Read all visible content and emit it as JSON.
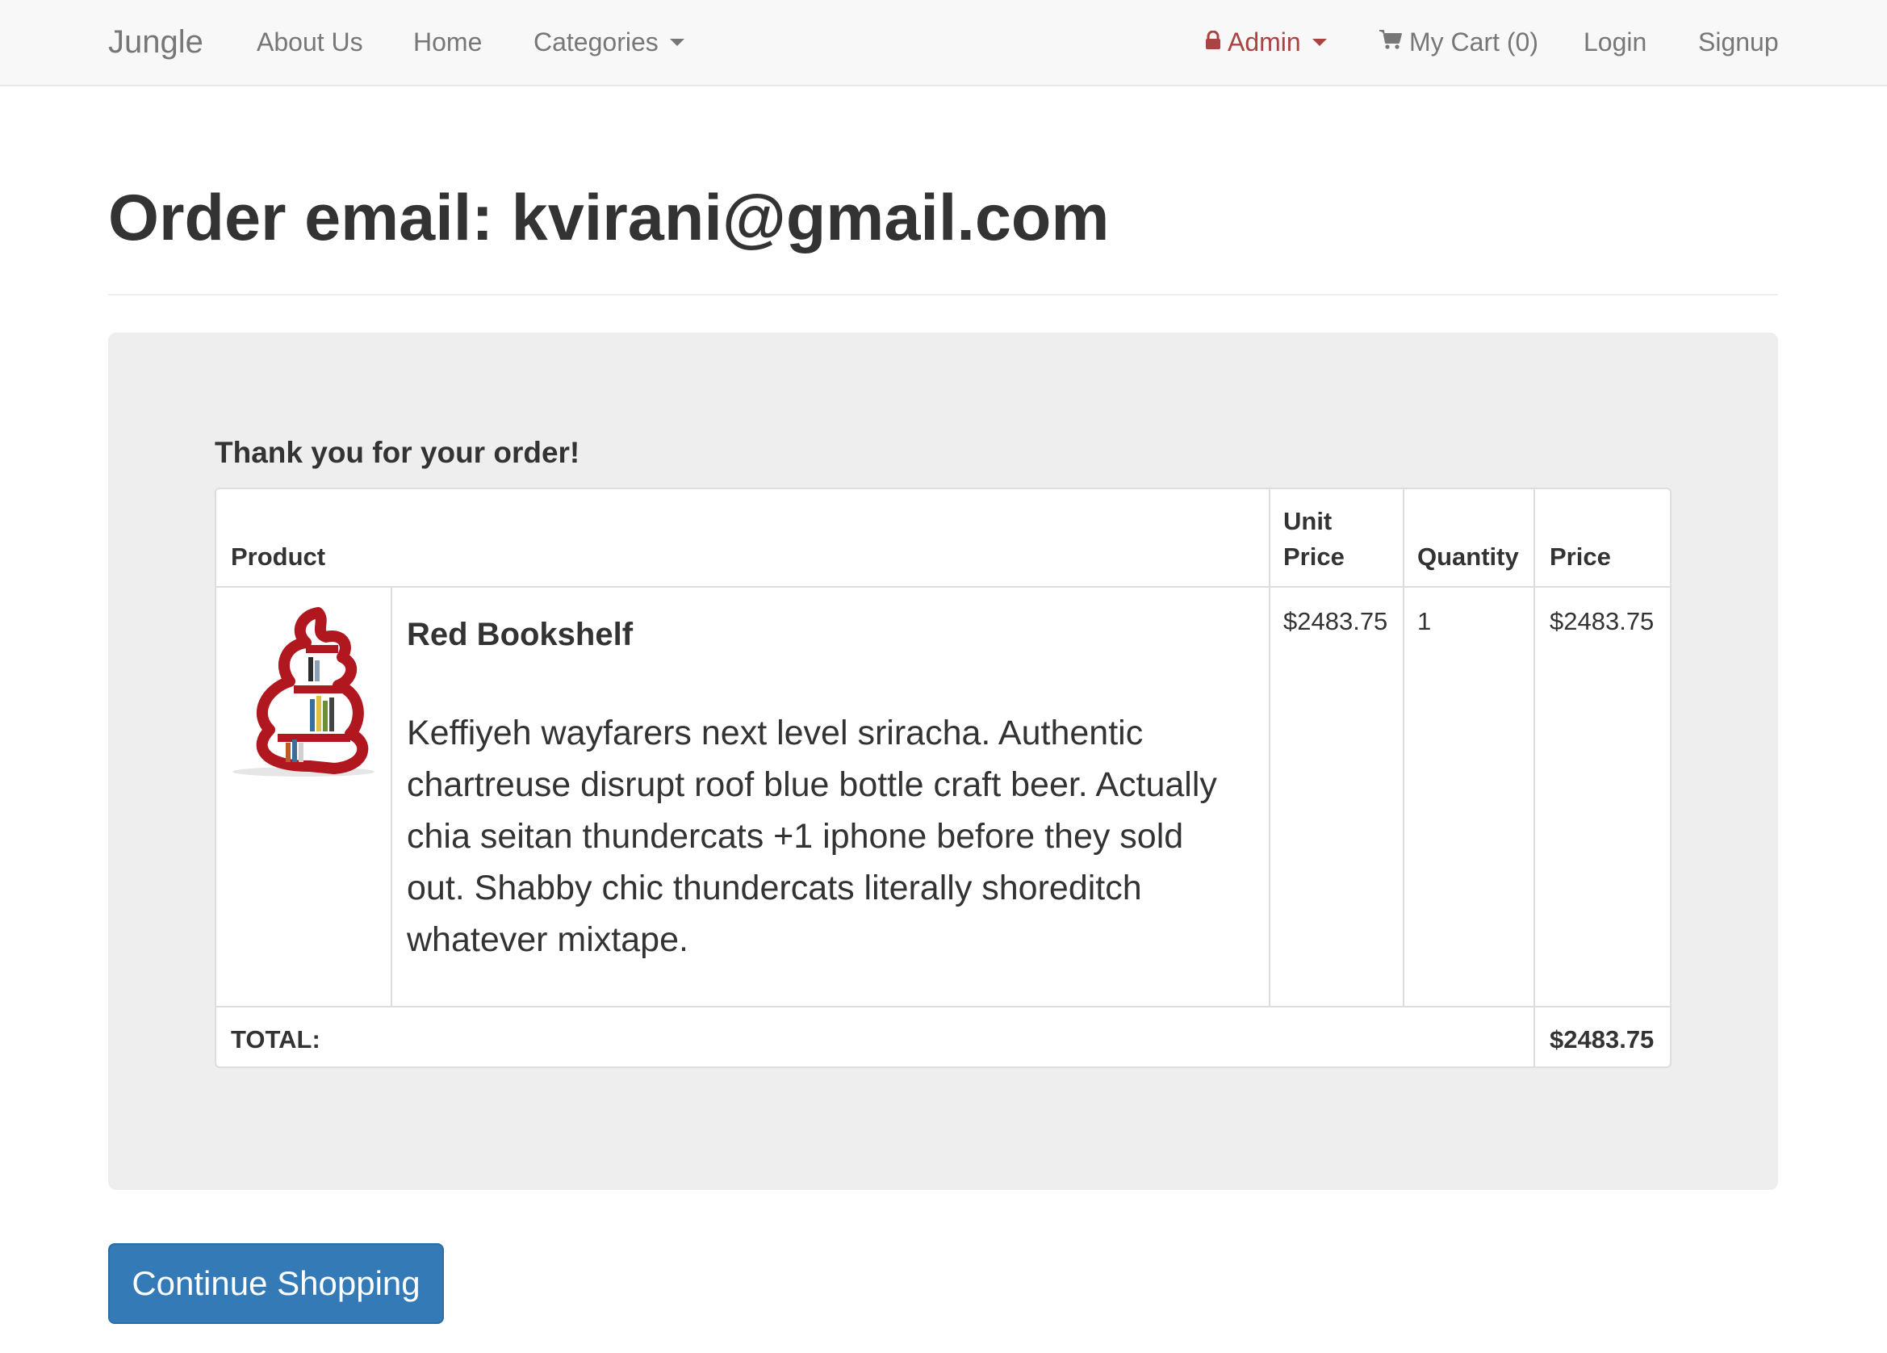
{
  "navbar": {
    "brand": "Jungle",
    "about": "About Us",
    "home": "Home",
    "categories": "Categories",
    "admin": "Admin",
    "cart": "My Cart (0)",
    "login": "Login",
    "signup": "Signup"
  },
  "page": {
    "title": "Order email: kvirani@gmail.com",
    "thanks": "Thank you for your order!"
  },
  "table": {
    "headers": {
      "product": "Product",
      "unit_price_line1": "Unit",
      "unit_price_line2": "Price",
      "quantity": "Quantity",
      "price": "Price"
    },
    "items": [
      {
        "name": "Red Bookshelf",
        "description": "Keffiyeh wayfarers next level sriracha. Authentic chartreuse disrupt roof blue bottle craft beer. Actually chia seitan thundercats +1 iphone before they sold out. Shabby chic thundercats literally shoreditch whatever mixtape.",
        "unit_price": "$2483.75",
        "quantity": "1",
        "price": "$2483.75"
      }
    ],
    "total_label": "TOTAL:",
    "total_value": "$2483.75"
  },
  "actions": {
    "continue_label": "Continue Shopping"
  },
  "colors": {
    "admin": "#a94442",
    "button": "#337ab7"
  },
  "icons": {
    "admin": "lock-icon",
    "cart": "shopping-cart-icon",
    "dropdown": "caret-down-icon"
  }
}
